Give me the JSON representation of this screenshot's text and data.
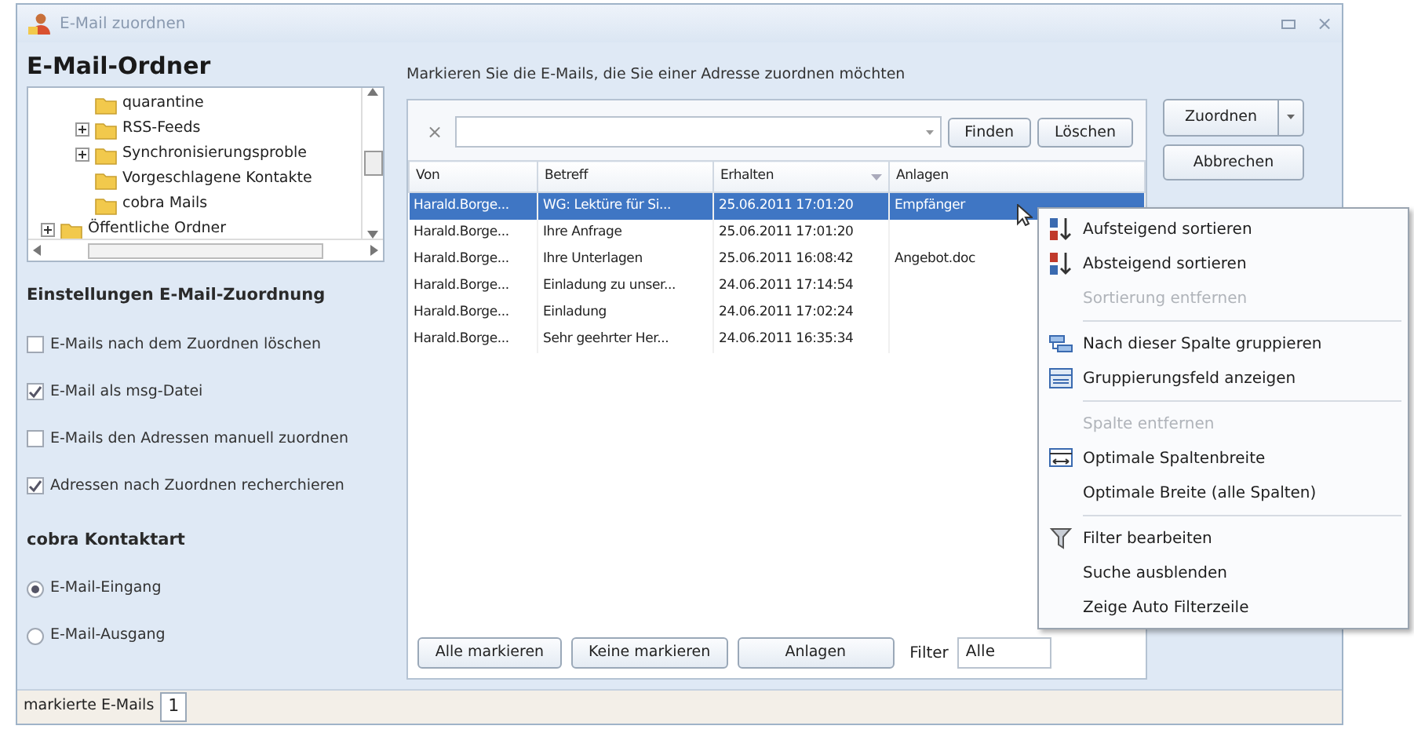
{
  "window": {
    "title": "E-Mail zuordnen",
    "close": "×"
  },
  "folders": {
    "title": "E-Mail-Ordner",
    "tree": [
      {
        "children": [
          {
            "label": "quarantine"
          },
          {
            "label": "RSS-Feeds",
            "expanded": false
          },
          {
            "label": "Synchronisierungsproble",
            "expanded": false
          },
          {
            "label": "Vorgeschlagene Kontakte"
          },
          {
            "label": "cobra Mails"
          }
        ]
      },
      {
        "label": "Öffentliche Ordner",
        "expanded": false
      }
    ]
  },
  "settings": {
    "title": "Einstellungen E-Mail-Zuordnung",
    "options": [
      {
        "label": "E-Mails nach dem Zuordnen löschen",
        "checked": false
      },
      {
        "label": "E-Mail als msg-Datei",
        "checked": true
      },
      {
        "label": "E-Mails den Adressen manuell zuordnen",
        "checked": false
      },
      {
        "label": "Adressen nach Zuordnen recherchieren",
        "checked": true
      }
    ]
  },
  "contact_type": {
    "title": "cobra Kontaktart",
    "options": [
      {
        "label": "E-Mail-Eingang",
        "selected": true
      },
      {
        "label": "E-Mail-Ausgang",
        "selected": false
      }
    ]
  },
  "instruction": "Markieren Sie die E-Mails, die Sie einer Adresse zuordnen möchten",
  "search": {
    "clear": "×",
    "buttons": [
      "Finden",
      "Löschen"
    ]
  },
  "side_buttons": [
    {
      "label": "Zuordnen",
      "kind": "split"
    },
    {
      "label": "Abbrechen",
      "kind": "plain"
    }
  ],
  "table": {
    "columns": [
      {
        "label": "Von"
      },
      {
        "label": "Betreff"
      },
      {
        "label": "Erhalten",
        "sorted": true
      },
      {
        "label": "Anlagen"
      }
    ],
    "rows": [
      {
        "selected": true,
        "cells": [
          "Harald.Borge...",
          "WG: Lektüre für Si...",
          "25.06.2011 17:01:20",
          "Empfänger"
        ]
      },
      {
        "selected": false,
        "cells": [
          "Harald.Borge...",
          "Ihre Anfrage",
          "25.06.2011 17:01:20",
          ""
        ]
      },
      {
        "selected": false,
        "cells": [
          "Harald.Borge...",
          "Ihre Unterlagen",
          "25.06.2011 16:08:42",
          "Angebot.doc"
        ]
      },
      {
        "selected": false,
        "cells": [
          "Harald.Borge...",
          "Einladung zu unser...",
          "24.06.2011 17:14:54",
          ""
        ]
      },
      {
        "selected": false,
        "cells": [
          "Harald.Borge...",
          "Einladung",
          "24.06.2011 17:02:24",
          ""
        ]
      },
      {
        "selected": false,
        "cells": [
          "Harald.Borge...",
          "Sehr geehrter Her...",
          "24.06.2011 16:35:34",
          ""
        ]
      }
    ]
  },
  "bottom_buttons": [
    "Alle markieren",
    "Keine markieren",
    "Anlagen"
  ],
  "filter": {
    "label": "Filter",
    "value": "Alle"
  },
  "context_menu": [
    {
      "label": "Aufsteigend sortieren",
      "kind": "sort_asc",
      "disabled": false
    },
    {
      "label": "Absteigend sortieren",
      "kind": "sort_desc",
      "disabled": false
    },
    {
      "label": "Sortierung entfernen",
      "kind": "plain",
      "disabled": true
    },
    {
      "kind": "separator"
    },
    {
      "label": "Nach dieser Spalte gruppieren",
      "kind": "group",
      "disabled": false
    },
    {
      "label": "Gruppierungsfeld anzeigen",
      "kind": "group_box",
      "disabled": false
    },
    {
      "kind": "separator"
    },
    {
      "label": "Spalte entfernen",
      "kind": "plain",
      "disabled": true
    },
    {
      "label": "Optimale Spaltenbreite",
      "kind": "fit",
      "disabled": false
    },
    {
      "label": "Optimale Breite (alle Spalten)",
      "kind": "plain",
      "disabled": false
    },
    {
      "kind": "separator"
    },
    {
      "label": "Filter bearbeiten",
      "kind": "filter",
      "disabled": false
    },
    {
      "label": "Suche ausblenden",
      "kind": "plain",
      "disabled": false
    },
    {
      "label": "Zeige Auto Filterzeile",
      "kind": "plain",
      "disabled": false
    }
  ],
  "status_bar": {
    "label": "markierte E-Mails",
    "value": "1"
  }
}
